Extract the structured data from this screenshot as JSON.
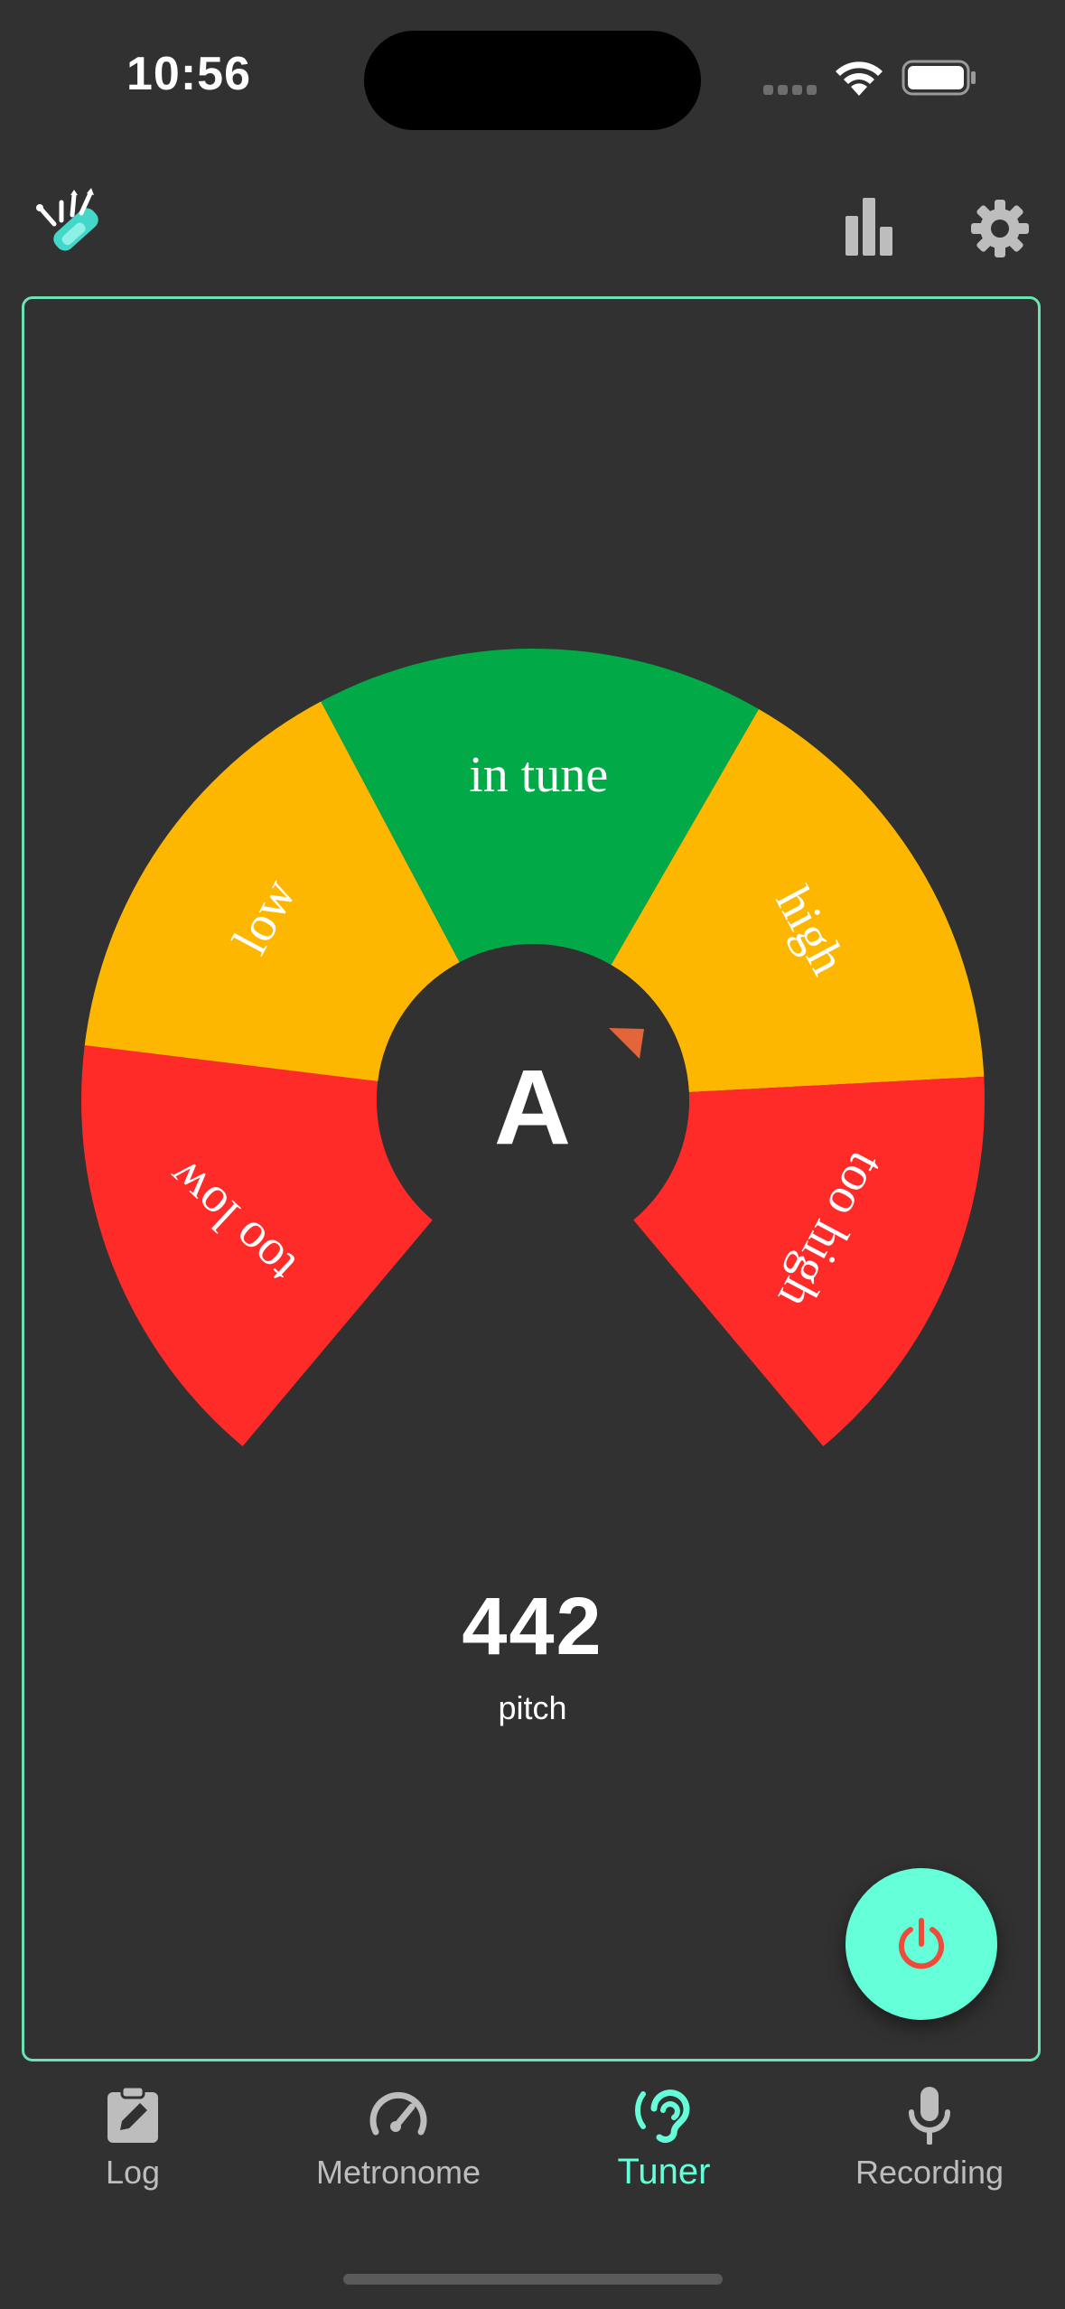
{
  "status_bar": {
    "time": "10:56"
  },
  "header": {
    "logo_icon": "multitool-icon",
    "stats_icon": "bar-chart-icon",
    "settings_icon": "gear-icon"
  },
  "tuner": {
    "segments": [
      {
        "label": "too low",
        "color": "#fe2b29"
      },
      {
        "label": "low",
        "color": "#feb701"
      },
      {
        "label": "in tune",
        "color": "#02aa47"
      },
      {
        "label": "high",
        "color": "#feb701"
      },
      {
        "label": "too high",
        "color": "#fe2b29"
      }
    ],
    "note": "A",
    "indicator_color": "#e5653b",
    "pitch_value": "442",
    "pitch_caption": "pitch",
    "power_icon": "power-icon",
    "power_color": "#ee4b3b"
  },
  "bottom_nav": {
    "items": [
      {
        "label": "Log",
        "icon": "clipboard-edit-icon",
        "active": false
      },
      {
        "label": "Metronome",
        "icon": "speedometer-icon",
        "active": false
      },
      {
        "label": "Tuner",
        "icon": "ear-icon",
        "active": true
      },
      {
        "label": "Recording",
        "icon": "microphone-icon",
        "active": false
      }
    ]
  },
  "colors": {
    "background": "#313131",
    "accent": "#64ffd8",
    "panel_border": "#6be3b3"
  }
}
